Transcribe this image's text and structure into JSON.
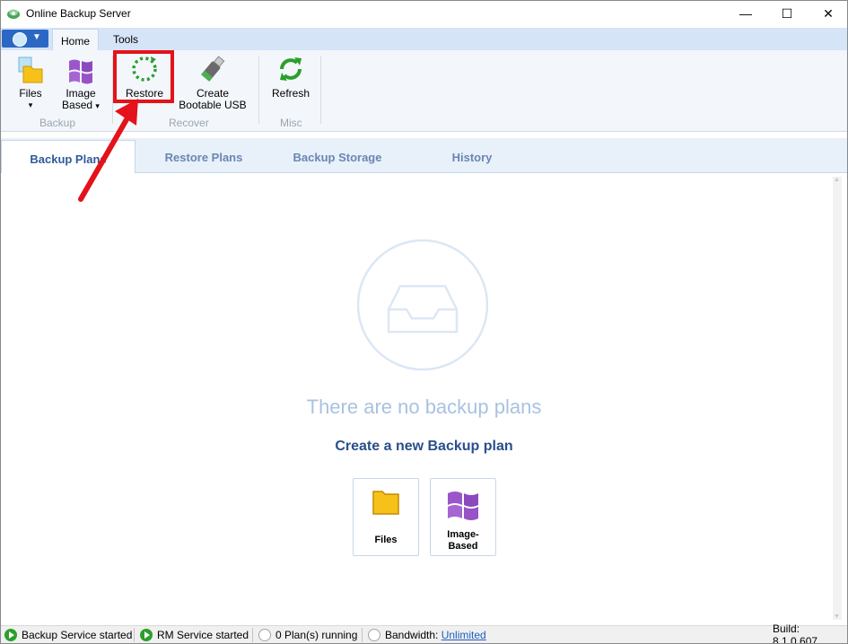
{
  "window": {
    "title": "Online Backup Server",
    "minimize_glyph": "—",
    "maximize_glyph": "☐",
    "close_glyph": "✕"
  },
  "ribbon_tabs": [
    {
      "label": "Home",
      "active": true
    },
    {
      "label": "Tools",
      "active": false
    }
  ],
  "ribbon": {
    "buttons": [
      {
        "label": "Files",
        "dropdown": "▾",
        "icon": "folder-icon",
        "group": "Backup"
      },
      {
        "label1": "Image",
        "label2": "Based",
        "dropdown": "▾",
        "icon": "windows-logo-icon",
        "group": "Backup"
      },
      {
        "label": "Restore",
        "icon": "restore-icon",
        "group": "Recover",
        "highlighted": true
      },
      {
        "label1": "Create",
        "label2": "Bootable USB",
        "icon": "usb-drive-icon",
        "group": "Recover"
      },
      {
        "label": "Refresh",
        "icon": "refresh-icon",
        "group": "Misc"
      }
    ],
    "groups": [
      "Backup",
      "Recover",
      "Misc"
    ]
  },
  "view_tabs": [
    {
      "label": "Backup Plans",
      "active": true
    },
    {
      "label": "Restore Plans",
      "active": false
    },
    {
      "label": "Backup Storage",
      "active": false
    },
    {
      "label": "History",
      "active": false
    }
  ],
  "empty_state": {
    "message": "There are no backup plans",
    "create_title": "Create a new Backup plan",
    "cards": [
      {
        "label": "Files",
        "icon": "folder-icon"
      },
      {
        "label1": "Image-",
        "label2": "Based",
        "icon": "windows-logo-icon"
      }
    ]
  },
  "status_bar": {
    "backup_service": "Backup Service started",
    "rm_service": "RM Service started",
    "plans_running": "0 Plan(s) running",
    "bandwidth_label": "Bandwidth:",
    "bandwidth_value": "Unlimited",
    "build": "Build: 8.1.0.607"
  },
  "colors": {
    "accent": "#2a4f8c",
    "highlight_box": "#e4121a",
    "status_ok": "#2aa02a",
    "empty_text": "#a8c2e0"
  }
}
